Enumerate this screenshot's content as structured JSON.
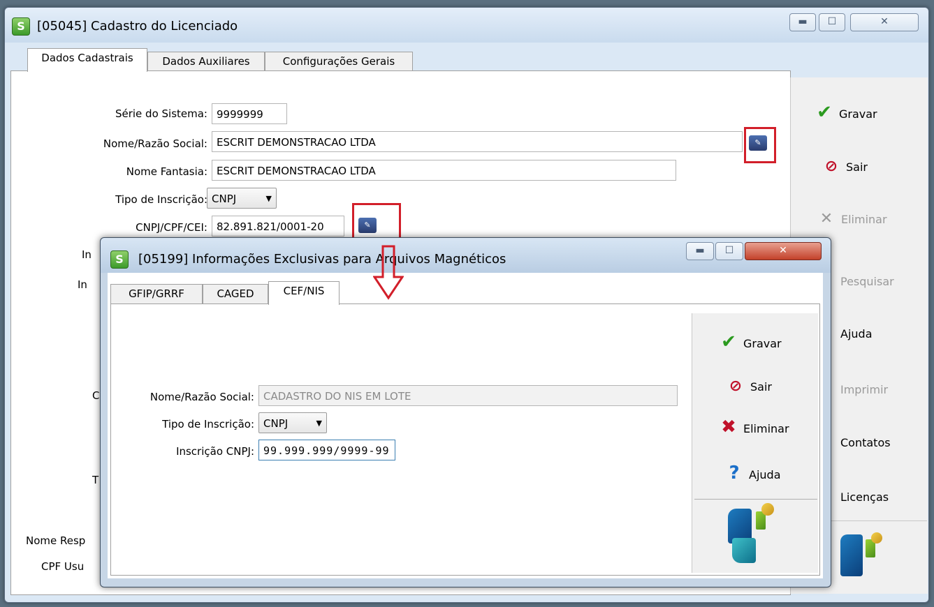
{
  "main_window": {
    "title": "[05045] Cadastro do Licenciado",
    "tabs": [
      "Dados Cadastrais",
      "Dados Auxiliares",
      "Configurações Gerais"
    ],
    "fields": {
      "serie_label": "Série do Sistema:",
      "serie_value": "9999999",
      "nome_label": "Nome/Razão Social:",
      "nome_value": "ESCRIT DEMONSTRACAO LTDA",
      "fantasia_label": "Nome Fantasia:",
      "fantasia_value": "ESCRIT DEMONSTRACAO LTDA",
      "tipo_label": "Tipo de Inscrição:",
      "tipo_value": "CNPJ",
      "cnpj_label": "CNPJ/CPF/CEI:",
      "cnpj_value": "82.891.821/0001-20",
      "partial_1": "In",
      "partial_2": "In",
      "partial_3": "C",
      "partial_4": "T",
      "nome_resp": "Nome Resp",
      "cpf_usu": "CPF Usu"
    },
    "sidebar": [
      "Gravar",
      "Sair",
      "Eliminar",
      "Pesquisar",
      "Ajuda",
      "Imprimir",
      "Contatos",
      "Licenças"
    ]
  },
  "child_window": {
    "title": "[05199] Informações Exclusivas para Arquivos Magnéticos",
    "tabs": [
      "GFIP/GRRF",
      "CAGED",
      "CEF/NIS"
    ],
    "fields": {
      "nome_label": "Nome/Razão Social:",
      "nome_value": "CADASTRO DO NIS EM LOTE",
      "tipo_label": "Tipo de Inscrição:",
      "tipo_value": "CNPJ",
      "cnpj_label": "Inscrição CNPJ:",
      "cnpj_value": "99.999.999/9999-99"
    },
    "sidebar": [
      "Gravar",
      "Sair",
      "Eliminar",
      "Ajuda"
    ]
  },
  "icons": {
    "app": "app-s-icon",
    "check": "✔",
    "stop": "⊘",
    "cross": "✕",
    "help": "?"
  },
  "colors": {
    "highlight": "#d21f2a",
    "ok": "#2b9a1f",
    "stop": "#c0112a"
  }
}
